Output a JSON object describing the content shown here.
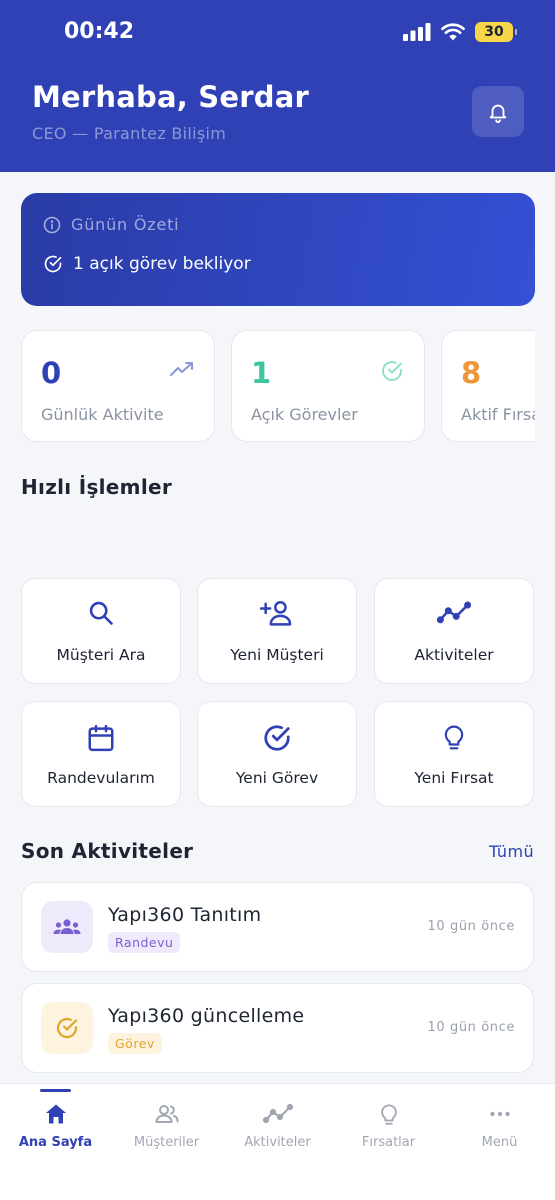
{
  "status_bar": {
    "time": "00:42",
    "battery": "30"
  },
  "header": {
    "greeting": "Merhaba, Serdar",
    "subtitle": "CEO — Parantez Bilişim"
  },
  "summary": {
    "title": "Günün Özeti",
    "line": "1 açık görev bekliyor"
  },
  "stats": [
    {
      "value": "0",
      "label": "Günlük Aktivite",
      "color": "#2f41b4",
      "icon": "trending-up-icon"
    },
    {
      "value": "1",
      "label": "Açık Görevler",
      "color": "#3cc5a0",
      "icon": "check-circle-icon"
    },
    {
      "value": "8",
      "label": "Aktif Fırsat",
      "color": "#f0963a",
      "icon": "lightbulb-icon"
    }
  ],
  "quick_actions": {
    "title": "Hızlı İşlemler",
    "items": [
      {
        "label": "Müşteri Ara",
        "icon": "search-icon"
      },
      {
        "label": "Yeni Müşteri",
        "icon": "add-person-icon"
      },
      {
        "label": "Aktiviteler",
        "icon": "activity-chart-icon"
      },
      {
        "label": "Randevularım",
        "icon": "calendar-icon"
      },
      {
        "label": "Yeni Görev",
        "icon": "check-circle-icon"
      },
      {
        "label": "Yeni Fırsat",
        "icon": "lightbulb-icon"
      }
    ]
  },
  "recent": {
    "title": "Son Aktiviteler",
    "see_all": "Tümü",
    "items": [
      {
        "title": "Yapı360 Tanıtım",
        "badge": "Randevu",
        "time": "10 gün önce",
        "icon": "group-icon"
      },
      {
        "title": "Yapı360 güncelleme",
        "badge": "Görev",
        "time": "10 gün önce",
        "icon": "check-circle-icon"
      }
    ]
  },
  "nav": {
    "items": [
      {
        "label": "Ana Sayfa",
        "icon": "home-icon",
        "active": true
      },
      {
        "label": "Müşteriler",
        "icon": "people-icon",
        "active": false
      },
      {
        "label": "Aktiviteler",
        "icon": "activity-chart-icon",
        "active": false
      },
      {
        "label": "Fırsatlar",
        "icon": "lightbulb-icon",
        "active": false
      },
      {
        "label": "Menü",
        "icon": "more-icon",
        "active": false
      }
    ]
  },
  "colors": {
    "primary": "#2f41b4",
    "teal": "#3cc5a0",
    "orange": "#f0963a",
    "purple": "#7b5fd1",
    "amber": "#e0a52d"
  }
}
